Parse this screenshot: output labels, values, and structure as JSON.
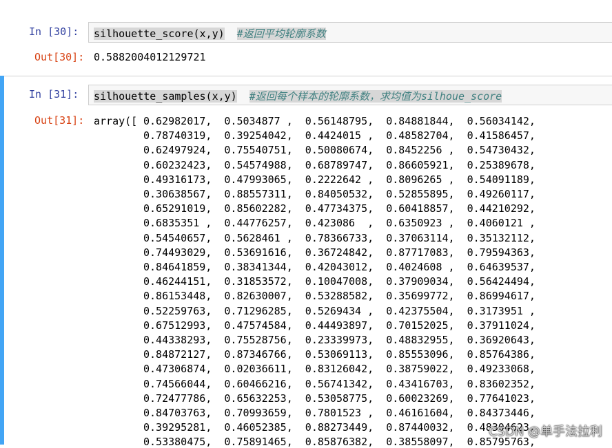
{
  "cells": [
    {
      "in_prompt": "In  [30]:",
      "code_fn": "silhouette_score(x,y)",
      "code_comment": "#返回平均轮廓系数",
      "out_prompt": "Out[30]:",
      "output": "0.5882004012129721"
    },
    {
      "in_prompt": "In  [31]:",
      "code_fn": "silhouette_samples(x,y)",
      "code_comment": "#返回每个样本的轮廓系数，求均值为silhoue_score",
      "out_prompt": "Out[31]:",
      "array_prefix": "array([",
      "rows": [
        "0.62982017,  0.5034877 ,  0.56148795,  0.84881844,  0.56034142,",
        "0.78740319,  0.39254042,  0.4424015 ,  0.48582704,  0.41586457,",
        "0.62497924,  0.75540751,  0.50080674,  0.8452256 ,  0.54730432,",
        "0.60232423,  0.54574988,  0.68789747,  0.86605921,  0.25389678,",
        "0.49316173,  0.47993065,  0.2222642 ,  0.8096265 ,  0.54091189,",
        "0.30638567,  0.88557311,  0.84050532,  0.52855895,  0.49260117,",
        "0.65291019,  0.85602282,  0.47734375,  0.60418857,  0.44210292,",
        "0.6835351 ,  0.44776257,  0.423086  ,  0.6350923 ,  0.4060121 ,",
        "0.54540657,  0.5628461 ,  0.78366733,  0.37063114,  0.35132112,",
        "0.74493029,  0.53691616,  0.36724842,  0.87717083,  0.79594363,",
        "0.84641859,  0.38341344,  0.42043012,  0.4024608 ,  0.64639537,",
        "0.46244151,  0.31853572,  0.10047008,  0.37909034,  0.56424494,",
        "0.86153448,  0.82630007,  0.53288582,  0.35699772,  0.86994617,",
        "0.52259763,  0.71296285,  0.5269434 ,  0.42375504,  0.3173951 ,",
        "0.67512993,  0.47574584,  0.44493897,  0.70152025,  0.37911024,",
        "0.44338293,  0.75528756,  0.23339973,  0.48832955,  0.36920643,",
        "0.84872127,  0.87346766,  0.53069113,  0.85553096,  0.85764386,",
        "0.47306874,  0.02036611,  0.83126042,  0.38759022,  0.49233068,",
        "0.74566044,  0.60466216,  0.56741342,  0.43416703,  0.83602352,",
        "0.72477786,  0.65632253,  0.53058775,  0.60023269,  0.77641023,",
        "0.84703763,  0.70993659,  0.7801523 ,  0.46161604,  0.84373446,",
        "0.39295281,  0.46052385,  0.88273449,  0.87440032,  0.48304623,",
        "0.53380475,  0.75891465,  0.85876382,  0.38558097,  0.85795763,"
      ]
    }
  ],
  "watermark": "CSDN @单手法拉利"
}
